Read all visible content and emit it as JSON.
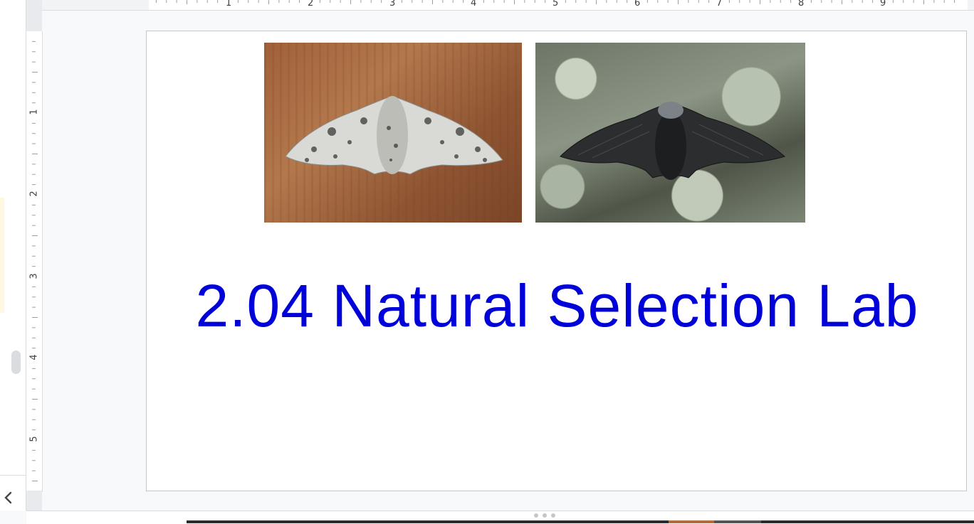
{
  "ruler": {
    "h_labels": [
      "1",
      "2",
      "3",
      "4",
      "5",
      "6",
      "7",
      "8",
      "9"
    ],
    "v_labels": [
      "1",
      "2",
      "3",
      "4",
      "5"
    ]
  },
  "slide": {
    "title": "2.04 Natural Selection Lab",
    "title_color": "#0000d9",
    "images": [
      {
        "name": "light peppered moth on wood"
      },
      {
        "name": "dark peppered moth on bark"
      }
    ]
  },
  "icons": {
    "collapse": "chevron-left-icon"
  }
}
